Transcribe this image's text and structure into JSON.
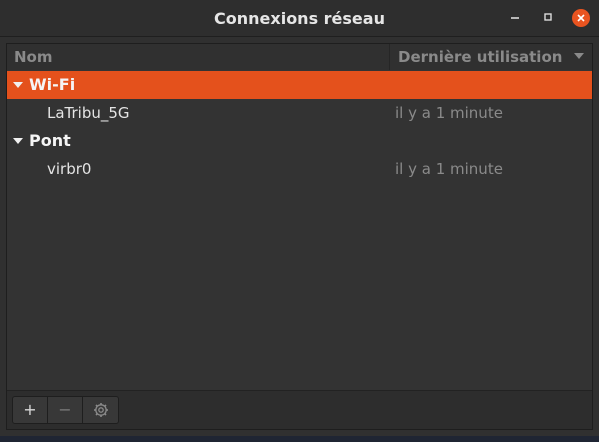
{
  "window": {
    "title": "Connexions réseau",
    "controls": {
      "minimize": "–",
      "maximize": "□",
      "close": "✕"
    }
  },
  "columns": {
    "name": "Nom",
    "last_used": "Dernière utilisation"
  },
  "groups": [
    {
      "label": "Wi-Fi",
      "expanded": true,
      "selected": true,
      "connections": [
        {
          "name": "LaTribu_5G",
          "last_used": "il y a 1 minute"
        }
      ]
    },
    {
      "label": "Pont",
      "expanded": true,
      "selected": false,
      "connections": [
        {
          "name": "virbr0",
          "last_used": "il y a 1 minute"
        }
      ]
    }
  ],
  "toolbar": {
    "add": "+",
    "remove": "−",
    "settings_icon": "gear-icon"
  },
  "colors": {
    "accent": "#e4511c",
    "close_button": "#e95420"
  }
}
